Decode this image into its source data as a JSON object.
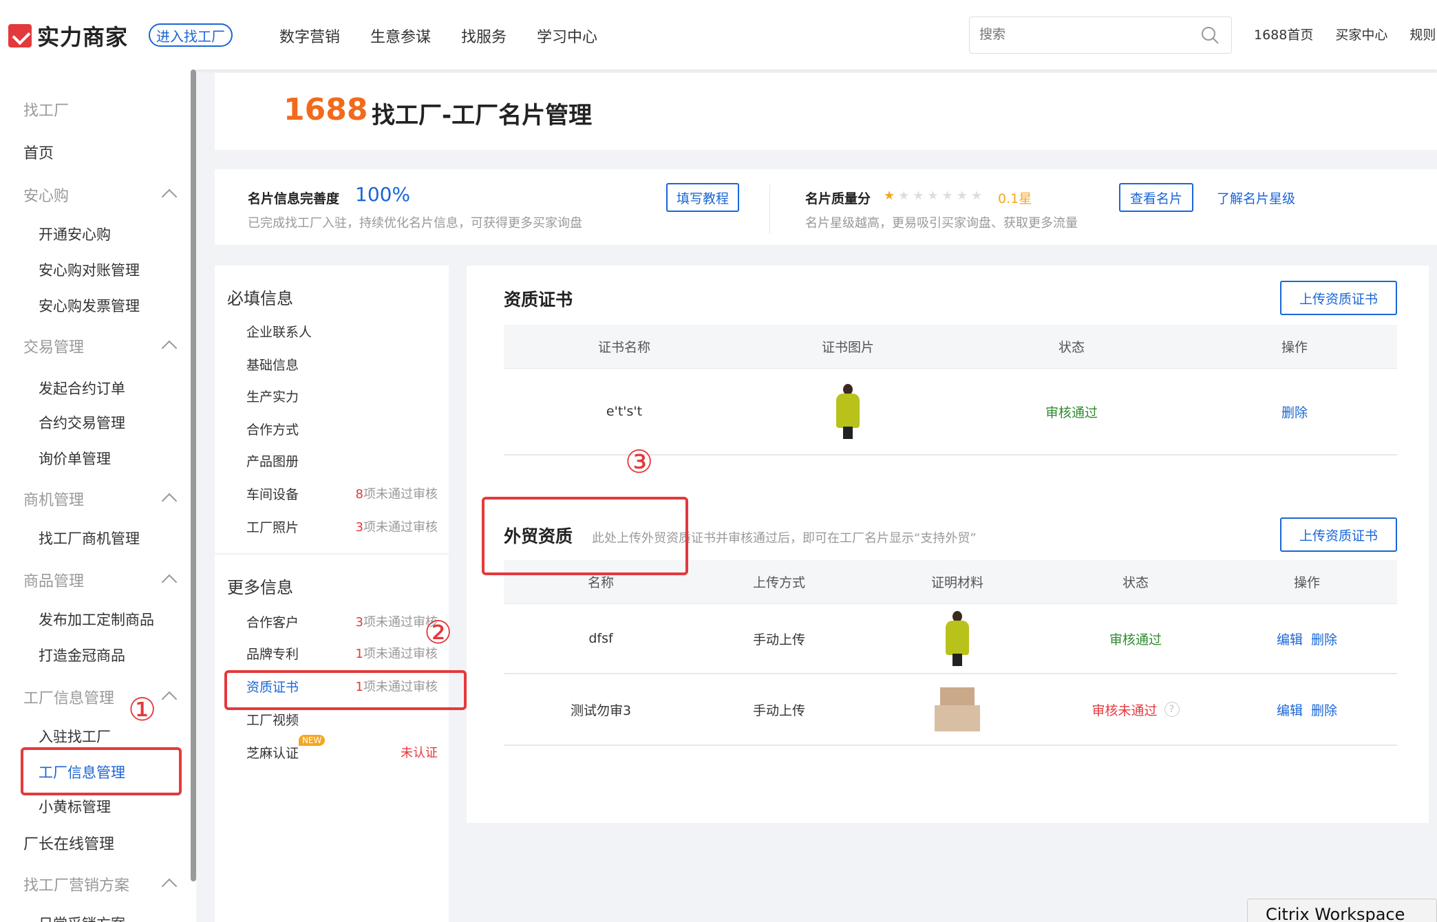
{
  "topbar": {
    "logo": "实力商家",
    "enter_btn": "进入找工厂",
    "nav": [
      "数字营销",
      "生意参谋",
      "找服务",
      "学习中心"
    ],
    "search_placeholder": "搜索",
    "links": [
      "1688首页",
      "买家中心",
      "规则"
    ]
  },
  "sidebar": {
    "title": "找工厂",
    "home": "首页",
    "groups": {
      "anxingou": "安心购",
      "jiaoyi": "交易管理",
      "shangji": "商机管理",
      "shangpin": "商品管理",
      "gongchang": "工厂信息管理",
      "yingxiao": "找工厂营销方案"
    },
    "items": {
      "kaitong": "开通安心购",
      "duizhang": "安心购对账管理",
      "fapiao": "安心购发票管理",
      "faqi": "发起合约订单",
      "heyue": "合约交易管理",
      "xunjia": "询价单管理",
      "shangji_mgmt": "找工厂商机管理",
      "fabu": "发布加工定制商品",
      "dazao": "打造金冠商品",
      "ruzhu": "入驻找工厂",
      "info_mgmt": "工厂信息管理",
      "huangbiao": "小黄标管理",
      "changzhang": "厂长在线管理",
      "richang": "日常采销方案"
    }
  },
  "header": {
    "brand": "1688",
    "title": "找工厂-工厂名片管理"
  },
  "stats": {
    "completeness_label": "名片信息完善度",
    "completeness_value": "100%",
    "completeness_desc": "已完成找工厂入驻，持续优化名片信息，可获得更多买家询盘",
    "tutorial_btn": "填写教程",
    "quality_label": "名片质量分",
    "quality_stars": 1,
    "quality_score": "0.1星",
    "quality_desc": "名片星级越高，更易吸引买家询盘、获取更多流量",
    "view_btn": "查看名片",
    "learn_link": "了解名片星级"
  },
  "menu": {
    "required_title": "必填信息",
    "required_items": [
      "企业联系人",
      "基础信息",
      "生产实力",
      "合作方式",
      "产品图册",
      "车间设备",
      "工厂照片"
    ],
    "more_title": "更多信息",
    "more_items": [
      "合作客户",
      "品牌专利",
      "资质证书",
      "工厂视频",
      "芝麻认证"
    ],
    "note_suffix": "项未通过审核",
    "notes": {
      "chejian": "8",
      "zhaopian": "3",
      "kehu": "3",
      "zhuanli": "1",
      "zhengshu": "1"
    },
    "new_tag": "NEW",
    "zhima_status": "未认证"
  },
  "certs": {
    "title": "资质证书",
    "upload_btn": "上传资质证书",
    "headers": [
      "证书名称",
      "证书图片",
      "状态",
      "操作"
    ],
    "rows": [
      {
        "name": "e't's't",
        "image": "yellow-coat-photo",
        "status": "审核通过",
        "action": "删除"
      }
    ]
  },
  "trade": {
    "title": "外贸资质",
    "hint": "此处上传外贸资质证书并审核通过后，即可在工厂名片显示“支持外贸”",
    "upload_btn": "上传资质证书",
    "headers": [
      "名称",
      "上传方式",
      "证明材料",
      "状态",
      "操作"
    ],
    "rows": [
      {
        "name": "dfsf",
        "method": "手动上传",
        "image": "yellow-coat-photo",
        "status": "审核通过",
        "edit": "编辑",
        "del": "删除"
      },
      {
        "name": "测试勿审3",
        "method": "手动上传",
        "image": "carton-box-photo",
        "status": "审核未通过",
        "edit": "编辑",
        "del": "删除"
      }
    ]
  },
  "annotations": {
    "one": "①",
    "two": "②",
    "three": "③"
  },
  "citrix": "Citrix Workspace",
  "colors": {
    "accent": "#1a66d6",
    "brand": "#f26a1b",
    "alert": "#e4393c",
    "success": "#2e8b2e",
    "star": "#f5a623"
  }
}
